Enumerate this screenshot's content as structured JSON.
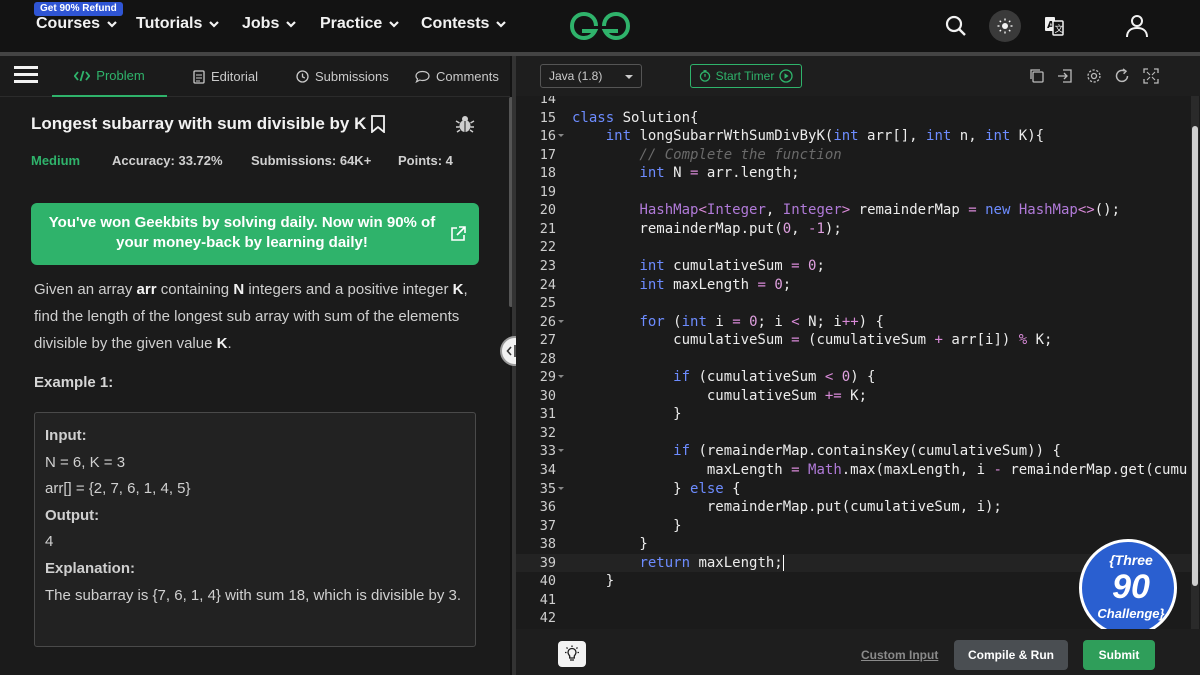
{
  "topnav": {
    "refund_badge": "Get 90% Refund",
    "items": [
      {
        "label": "Courses"
      },
      {
        "label": "Tutorials"
      },
      {
        "label": "Jobs"
      },
      {
        "label": "Practice"
      },
      {
        "label": "Contests"
      }
    ],
    "brand_color": "#2fb36b"
  },
  "tabs": [
    {
      "label": "Problem",
      "icon": "code-icon",
      "active": true
    },
    {
      "label": "Editorial",
      "icon": "document-icon"
    },
    {
      "label": "Submissions",
      "icon": "clock-icon"
    },
    {
      "label": "Comments",
      "icon": "chat-icon"
    }
  ],
  "problem": {
    "title": "Longest subarray with sum divisible by K",
    "difficulty": "Medium",
    "accuracy": "Accuracy: 33.72%",
    "submissions": "Submissions: 64K+",
    "points": "Points: 4",
    "promo": "You've won Geekbits by solving daily. Now win 90% of your money-back by learning daily!",
    "desc": {
      "p1": "Given an array ",
      "arr": "arr",
      "p2": " containing ",
      "n": "N",
      "p3": " integers and a positive integer ",
      "k": "K",
      "p4": ", find the length of the longest sub array with sum of the elements divisible by the given value ",
      "k2": "K",
      "p5": "."
    },
    "example_title": "Example 1:",
    "example": {
      "input_label": "Input:",
      "input_l1": "N = 6, K = 3",
      "input_l2": "arr[] = {2, 7, 6, 1, 4, 5}",
      "output_label": "Output:",
      "output": "4",
      "explanation_label": "Explanation:",
      "explanation": "The subarray is {7, 6, 1, 4} with sum 18, which is divisible by 3."
    }
  },
  "editor": {
    "language": "Java (1.8)",
    "timer_label": "Start Timer",
    "custom_input": "Custom Input",
    "compile_label": "Compile & Run",
    "submit_label": "Submit",
    "badge": {
      "line1": "{Three",
      "line2": "90",
      "line3": "Challenge}"
    },
    "lines": [
      {
        "n": "14",
        "code": ""
      },
      {
        "n": "15",
        "code": "class Solution{"
      },
      {
        "n": "16",
        "code": "    int longSubarrWthSumDivByK(int arr[], int n, int K){"
      },
      {
        "n": "17",
        "code": "        // Complete the function"
      },
      {
        "n": "18",
        "code": "        int N = arr.length;"
      },
      {
        "n": "19",
        "code": ""
      },
      {
        "n": "20",
        "code": "        HashMap<Integer, Integer> remainderMap = new HashMap<>();"
      },
      {
        "n": "21",
        "code": "        remainderMap.put(0, -1);"
      },
      {
        "n": "22",
        "code": ""
      },
      {
        "n": "23",
        "code": "        int cumulativeSum = 0;"
      },
      {
        "n": "24",
        "code": "        int maxLength = 0;"
      },
      {
        "n": "25",
        "code": ""
      },
      {
        "n": "26",
        "code": "        for (int i = 0; i < N; i++) {"
      },
      {
        "n": "27",
        "code": "            cumulativeSum = (cumulativeSum + arr[i]) % K;"
      },
      {
        "n": "28",
        "code": ""
      },
      {
        "n": "29",
        "code": "            if (cumulativeSum < 0) {"
      },
      {
        "n": "30",
        "code": "                cumulativeSum += K;"
      },
      {
        "n": "31",
        "code": "            }"
      },
      {
        "n": "32",
        "code": ""
      },
      {
        "n": "33",
        "code": "            if (remainderMap.containsKey(cumulativeSum)) {"
      },
      {
        "n": "34",
        "code": "                maxLength = Math.max(maxLength, i - remainderMap.get(cumu"
      },
      {
        "n": "35",
        "code": "            } else {"
      },
      {
        "n": "36",
        "code": "                remainderMap.put(cumulativeSum, i);"
      },
      {
        "n": "37",
        "code": "            }"
      },
      {
        "n": "38",
        "code": "        }"
      },
      {
        "n": "39",
        "code": "        return maxLength;"
      },
      {
        "n": "40",
        "code": "    }"
      },
      {
        "n": "41",
        "code": ""
      },
      {
        "n": "42",
        "code": ""
      }
    ]
  }
}
